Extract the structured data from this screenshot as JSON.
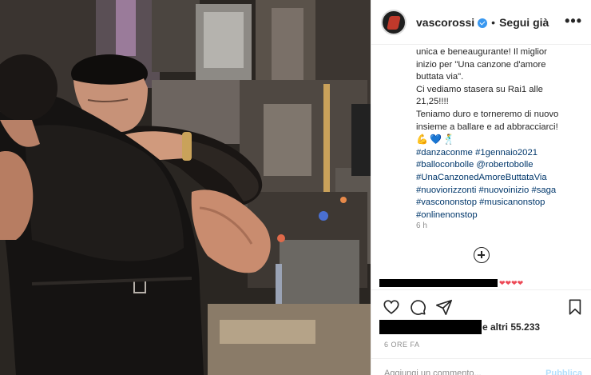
{
  "post": {
    "username": "vascorossi",
    "separator": "•",
    "follow_label": "Segui già",
    "more_label": "•••",
    "caption_lines": [
      "unica e beneaugurante! Il miglior",
      "inizio per \"Una canzone d'amore",
      "buttata via\".",
      "Ci vediamo stasera su Rai1 alle",
      "21,25!!!!",
      "Teniamo duro e torneremo di nuovo",
      "insieme a ballare e ad abbracciarci!"
    ],
    "emoji_line": [
      "💪",
      "💙",
      "🕺"
    ],
    "hashtag_lines": [
      "#danzaconme #1gennaio2021",
      "#balloconbolle @robertobolle",
      "#UnaCanzonedAmoreButtataVia",
      "#nuoviorizzonti #nuovoinizio #saga",
      "#vascononstop #musicanonstop",
      "#onlinenonstop"
    ],
    "caption_time": "6 h",
    "comment_hearts": "❤❤❤❤",
    "likes_text": "e altri 55.233",
    "posted_ago": "6 ORE FA",
    "comment_placeholder": "Aggiungi un commento...",
    "publish_label": "Pubblica"
  },
  "icons": {
    "like": "heart-icon",
    "comment": "comment-icon",
    "share": "share-icon",
    "save": "bookmark-icon",
    "load_more": "plus-circle-icon",
    "verified": "verified-badge-icon",
    "options": "more-options-icon"
  },
  "colors": {
    "text": "#262626",
    "muted": "#8e8e8e",
    "link": "#00376b",
    "verified": "#3897f0",
    "publish": "#b2dffc",
    "border": "#efefef"
  }
}
